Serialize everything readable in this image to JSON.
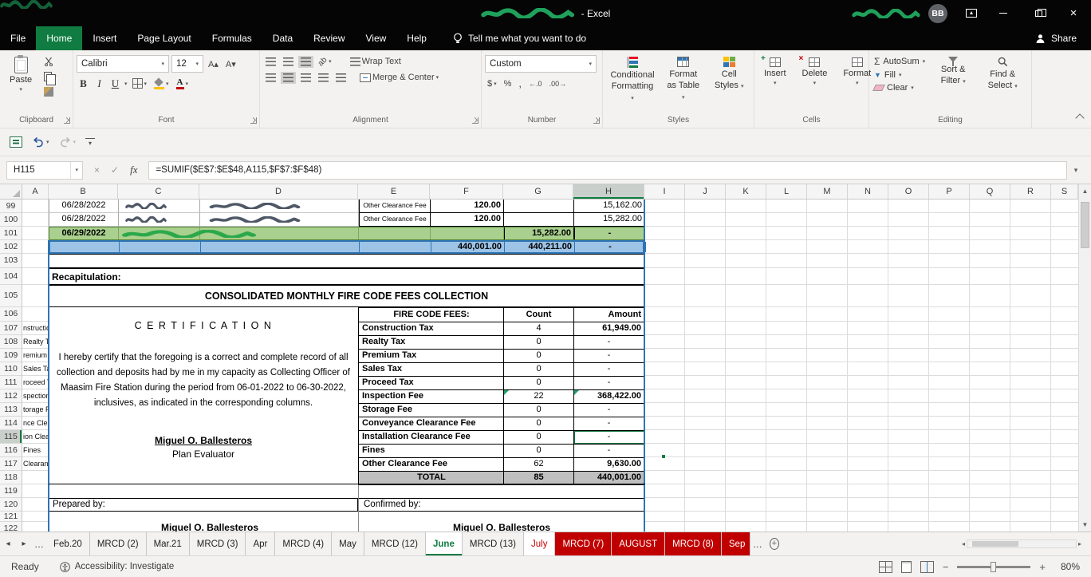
{
  "titlebar": {
    "title_suffix": "- Excel",
    "avatar_initials": "BB"
  },
  "ribbon_tabs": {
    "items": [
      "File",
      "Home",
      "Insert",
      "Page Layout",
      "Formulas",
      "Data",
      "Review",
      "View",
      "Help"
    ],
    "active_index": 1,
    "tell_me": "Tell me what you want to do",
    "share_label": "Share"
  },
  "ribbon": {
    "clipboard": {
      "group_label": "Clipboard",
      "paste_label": "Paste"
    },
    "font": {
      "group_label": "Font",
      "font_name": "Calibri",
      "font_size": "12"
    },
    "alignment": {
      "group_label": "Alignment",
      "wrap_text": "Wrap Text",
      "merge_center": "Merge & Center",
      "orientation": "ab"
    },
    "number": {
      "group_label": "Number",
      "format_value": "Custom"
    },
    "styles": {
      "group_label": "Styles",
      "buttons": [
        "Conditional Formatting",
        "Format as Table",
        "Cell Styles"
      ]
    },
    "cells": {
      "group_label": "Cells",
      "insert": "Insert",
      "delete": "Delete",
      "format": "Format"
    },
    "editing": {
      "group_label": "Editing",
      "autosum": "AutoSum",
      "fill": "Fill",
      "clear": "Clear",
      "sort_filter": "Sort & Filter",
      "find_select": "Find & Select"
    }
  },
  "formula_bar": {
    "name_box": "H115",
    "fx_label": "fx",
    "formula": "=SUMIF($E$7:$E$48,A115,$F$7:$F$48)"
  },
  "grid": {
    "selected_cell": "H115",
    "selected_column": "H",
    "selected_row": 115,
    "columns": [
      {
        "letter": "A",
        "width": 33
      },
      {
        "letter": "B",
        "width": 87
      },
      {
        "letter": "C",
        "width": 102
      },
      {
        "letter": "D",
        "width": 199
      },
      {
        "letter": "E",
        "width": 90
      },
      {
        "letter": "F",
        "width": 92
      },
      {
        "letter": "G",
        "width": 88
      },
      {
        "letter": "H",
        "width": 89
      },
      {
        "letter": "I",
        "width": 51
      },
      {
        "letter": "J",
        "width": 51
      },
      {
        "letter": "K",
        "width": 51
      },
      {
        "letter": "L",
        "width": 51
      },
      {
        "letter": "M",
        "width": 51
      },
      {
        "letter": "N",
        "width": 51
      },
      {
        "letter": "O",
        "width": 51
      },
      {
        "letter": "P",
        "width": 51
      },
      {
        "letter": "Q",
        "width": 51
      },
      {
        "letter": "R",
        "width": 51
      },
      {
        "letter": "S",
        "width": 34
      }
    ],
    "rows": [
      {
        "n": 99,
        "h": 17
      },
      {
        "n": 100,
        "h": 17
      },
      {
        "n": 101,
        "h": 17
      },
      {
        "n": 102,
        "h": 17
      },
      {
        "n": 103,
        "h": 18
      },
      {
        "n": 104,
        "h": 21
      },
      {
        "n": 105,
        "h": 28
      },
      {
        "n": 106,
        "h": 18
      },
      {
        "n": 107,
        "h": 17
      },
      {
        "n": 108,
        "h": 17
      },
      {
        "n": 109,
        "h": 17
      },
      {
        "n": 110,
        "h": 17
      },
      {
        "n": 111,
        "h": 17
      },
      {
        "n": 112,
        "h": 17
      },
      {
        "n": 113,
        "h": 17
      },
      {
        "n": 114,
        "h": 17
      },
      {
        "n": 115,
        "h": 17
      },
      {
        "n": 116,
        "h": 17
      },
      {
        "n": 117,
        "h": 17
      },
      {
        "n": 118,
        "h": 17
      },
      {
        "n": 119,
        "h": 17
      },
      {
        "n": 120,
        "h": 17
      },
      {
        "n": 121,
        "h": 13
      },
      {
        "n": 122,
        "h": 17
      }
    ],
    "a_column_fragments": [
      {
        "row": 107,
        "text": "nstruction"
      },
      {
        "row": 108,
        "text": "Realty Tax"
      },
      {
        "row": 109,
        "text": "remium Ta"
      },
      {
        "row": 110,
        "text": "Sales Tax"
      },
      {
        "row": 111,
        "text": "roceed Ta"
      },
      {
        "row": 112,
        "text": "spection Fe"
      },
      {
        "row": 113,
        "text": "torage Fee"
      },
      {
        "row": 114,
        "text": "nce Cleara"
      },
      {
        "row": 115,
        "text": "ion Cleara"
      },
      {
        "row": 116,
        "text": "Fines"
      },
      {
        "row": 117,
        "text": "Clearance"
      }
    ]
  },
  "sheet": {
    "ledger_rows": [
      {
        "row": 99,
        "date": "06/28/2022",
        "fee": "Other Clearance Fee",
        "col_f": "120.00",
        "col_g": "",
        "col_h": "15,162.00",
        "variant": "plain"
      },
      {
        "row": 100,
        "date": "06/28/2022",
        "fee": "Other Clearance Fee",
        "col_f": "120.00",
        "col_g": "",
        "col_h": "15,282.00",
        "variant": "plain"
      },
      {
        "row": 101,
        "date": "06/29/2022",
        "fee": "",
        "col_f": "",
        "col_g": "15,282.00",
        "col_h": "-",
        "variant": "green"
      },
      {
        "row": 102,
        "date": "",
        "fee": "",
        "col_f": "440,001.00",
        "col_g": "440,211.00",
        "col_h": "-",
        "variant": "blue"
      }
    ],
    "recap_label": "Recapitulation:",
    "consolidated_title": "CONSOLIDATED MONTHLY FIRE CODE FEES COLLECTION",
    "fee_table": {
      "header": {
        "fees": "FIRE CODE FEES:",
        "count": "Count",
        "amount": "Amount"
      },
      "rows": [
        {
          "name": "Construction Tax",
          "count": "4",
          "amount": "61,949.00"
        },
        {
          "name": "Realty Tax",
          "count": "0",
          "amount": "-"
        },
        {
          "name": "Premium Tax",
          "count": "0",
          "amount": "-"
        },
        {
          "name": "Sales Tax",
          "count": "0",
          "amount": "-"
        },
        {
          "name": "Proceed Tax",
          "count": "0",
          "amount": "-"
        },
        {
          "name": "Inspection Fee",
          "count": "22",
          "amount": "368,422.00",
          "flag": true
        },
        {
          "name": "Storage Fee",
          "count": "0",
          "amount": "-"
        },
        {
          "name": "Conveyance Clearance Fee",
          "count": "0",
          "amount": "-"
        },
        {
          "name": "Installation Clearance Fee",
          "count": "0",
          "amount": "-",
          "selected": true
        },
        {
          "name": "Fines",
          "count": "0",
          "amount": "-"
        },
        {
          "name": "Other Clearance Fee",
          "count": "62",
          "amount": "9,630.00"
        }
      ],
      "total": {
        "name": "TOTAL",
        "count": "85",
        "amount": "440,001.00"
      }
    },
    "certification": {
      "title": "C E R T I F I C A T I O N",
      "body": "I hereby certify that the foregoing is a correct and complete record of all collection and deposits had by me in my capacity as Collecting Officer of Maasim Fire Station during the period from 06-01-2022  to  06-30-2022, inclusives, as indicated in the corresponding columns.",
      "signatory": "Miguel O. Ballesteros",
      "signatory_title": "Plan Evaluator"
    },
    "footer": {
      "prepared_by": "Prepared by:",
      "confirmed_by": "Confirmed by:",
      "prepared_name": "Miguel O. Ballesteros",
      "confirmed_name": "Miguel O. Ballesteros"
    }
  },
  "sheet_tabs": {
    "tabs": [
      {
        "label": "Feb.20",
        "variant": "normal"
      },
      {
        "label": "MRCD (2)",
        "variant": "normal"
      },
      {
        "label": "Mar.21",
        "variant": "normal"
      },
      {
        "label": "MRCD (3)",
        "variant": "normal"
      },
      {
        "label": "Apr",
        "variant": "normal"
      },
      {
        "label": "MRCD (4)",
        "variant": "normal"
      },
      {
        "label": "May",
        "variant": "normal"
      },
      {
        "label": "MRCD (12)",
        "variant": "normal"
      },
      {
        "label": "June",
        "variant": "active"
      },
      {
        "label": "MRCD (13)",
        "variant": "normal"
      },
      {
        "label": "July",
        "variant": "red-text"
      },
      {
        "label": "MRCD (7)",
        "variant": "red-fill"
      },
      {
        "label": "AUGUST",
        "variant": "red-fill"
      },
      {
        "label": "MRCD (8)",
        "variant": "red-fill"
      },
      {
        "label": "Sep",
        "variant": "red-fill",
        "cut": true
      }
    ]
  },
  "status_bar": {
    "mode": "Ready",
    "accessibility": "Accessibility: Investigate",
    "zoom_level": "80%"
  },
  "icons": {
    "dropdown": "▾",
    "up_arrow": "▲",
    "down_arrow": "▼",
    "left_tri": "◂",
    "right_tri": "▸",
    "close": "×",
    "check": "✓",
    "minus": "−",
    "plus": "+",
    "ellipsis": "…",
    "sigma": "Σ",
    "percent": "%",
    "comma": ",",
    "accounting": "$",
    "inc_decimal": "←.0",
    "dec_decimal": ".00→",
    "bold": "B",
    "italic": "I",
    "underline": "U",
    "font_a": "A",
    "inc_font": "A▴",
    "dec_font": "A▾"
  },
  "colors": {
    "excel_green": "#107C41",
    "tab_red": "#C00000",
    "row_green": "#A9D08E",
    "row_blue": "#9DC3E6",
    "total_gray": "#BFBFBF",
    "border_blue": "#2E75B6"
  }
}
